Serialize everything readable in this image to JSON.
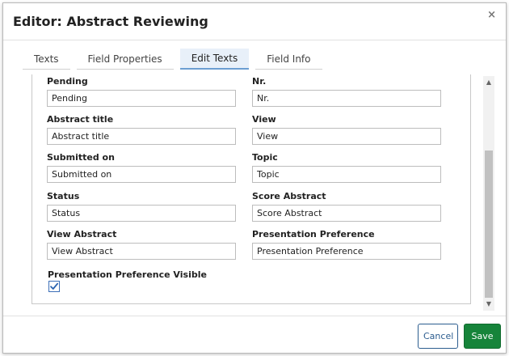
{
  "dialog": {
    "title": "Editor: Abstract Reviewing",
    "close_glyph": "×"
  },
  "tabs": [
    {
      "label": "Texts"
    },
    {
      "label": "Field Properties"
    },
    {
      "label": "Edit Texts",
      "active": true
    },
    {
      "label": "Field Info"
    }
  ],
  "fields": {
    "pending": {
      "label": "Pending",
      "value": "Pending"
    },
    "nr": {
      "label": "Nr.",
      "value": "Nr."
    },
    "abstract_title": {
      "label": "Abstract title",
      "value": "Abstract title"
    },
    "view": {
      "label": "View",
      "value": "View"
    },
    "submitted_on": {
      "label": "Submitted on",
      "value": "Submitted on"
    },
    "topic": {
      "label": "Topic",
      "value": "Topic"
    },
    "status": {
      "label": "Status",
      "value": "Status"
    },
    "score_abstract": {
      "label": "Score Abstract",
      "value": "Score Abstract"
    },
    "view_abstract": {
      "label": "View Abstract",
      "value": "View Abstract"
    },
    "presentation_preference": {
      "label": "Presentation Preference",
      "value": "Presentation Preference"
    }
  },
  "presentation_preference_visible": {
    "label": "Presentation Preference Visible",
    "checked": true
  },
  "scrollbar": {
    "up_glyph": "▲",
    "down_glyph": "▼"
  },
  "footer": {
    "cancel_label": "Cancel",
    "save_label": "Save"
  },
  "colors": {
    "save_button": "#16843a",
    "cancel_border": "#2c5d8f",
    "active_tab": "#e8f0f9",
    "checkbox_check": "#2a63b0"
  }
}
